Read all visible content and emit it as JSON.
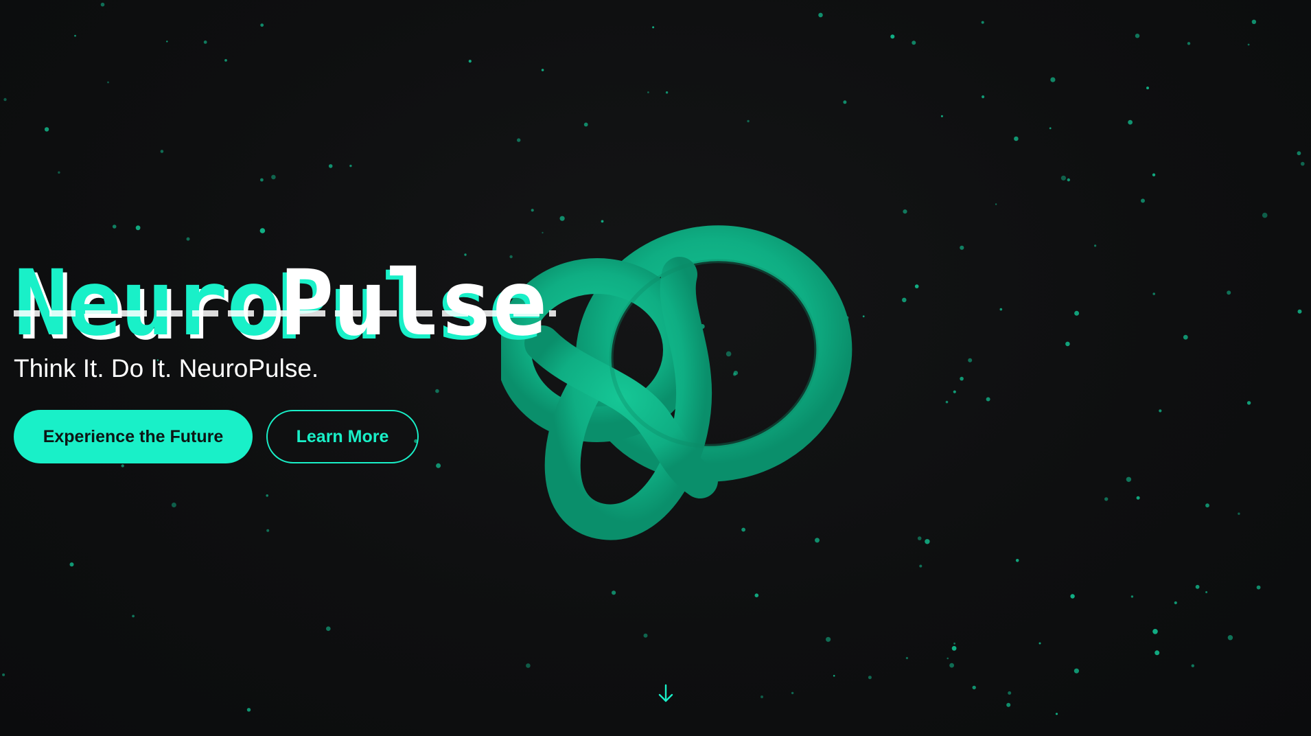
{
  "hero": {
    "title_part1": "Neuro",
    "title_part2": "Pulse",
    "tagline": "Think It. Do It. NeuroPulse.",
    "primary_button": "Experience the Future",
    "secondary_button": "Learn More"
  },
  "icons": {
    "scroll": "arrow-down-icon",
    "hero_graphic": "torus-knot-icon"
  },
  "colors": {
    "accent": "#19f0c8",
    "knot": "#10b88a",
    "background": "#0e0f10",
    "text": "#ffffff"
  }
}
